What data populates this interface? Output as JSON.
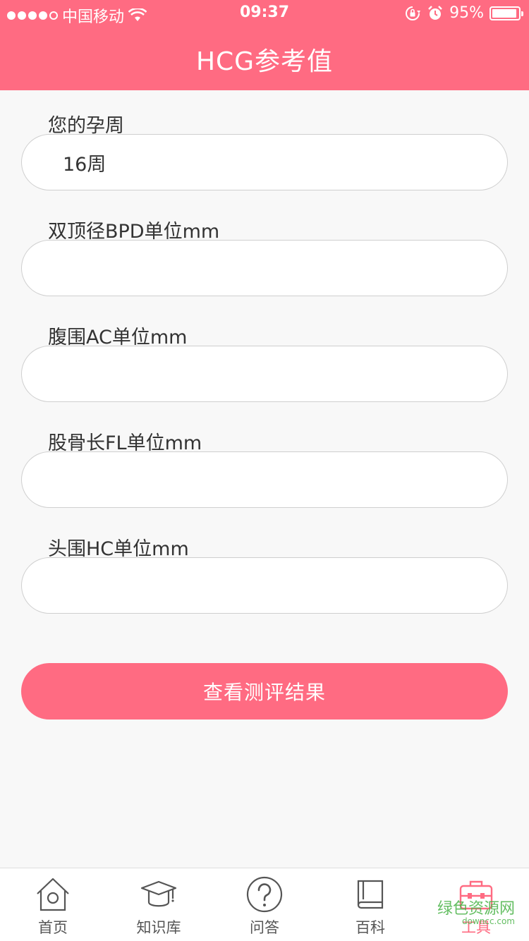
{
  "status_bar": {
    "carrier": "中国移动",
    "time": "09:37",
    "battery_percent": "95%",
    "battery_level": 0.95,
    "signal_filled": 4,
    "signal_total": 5
  },
  "header": {
    "title": "HCG参考值"
  },
  "form": {
    "fields": [
      {
        "label": "您的孕周",
        "value": "16周",
        "placeholder": ""
      },
      {
        "label": "双顶径BPD单位mm",
        "value": "",
        "placeholder": ""
      },
      {
        "label": "腹围AC单位mm",
        "value": "",
        "placeholder": ""
      },
      {
        "label": "股骨长FL单位mm",
        "value": "",
        "placeholder": ""
      },
      {
        "label": "头围HC单位mm",
        "value": "",
        "placeholder": ""
      }
    ],
    "submit_label": "查看测评结果"
  },
  "tabbar": {
    "items": [
      {
        "label": "首页",
        "icon": "home-icon"
      },
      {
        "label": "知识库",
        "icon": "graduation-cap-icon"
      },
      {
        "label": "问答",
        "icon": "question-circle-icon"
      },
      {
        "label": "百科",
        "icon": "book-icon"
      },
      {
        "label": "工具",
        "icon": "toolbox-icon",
        "active": true
      }
    ]
  },
  "watermark": {
    "text": "绿色资源网",
    "sub": "downcc.com"
  },
  "colors": {
    "accent": "#ff6b82",
    "background": "#f8f8f8",
    "watermark": "#49b347"
  }
}
